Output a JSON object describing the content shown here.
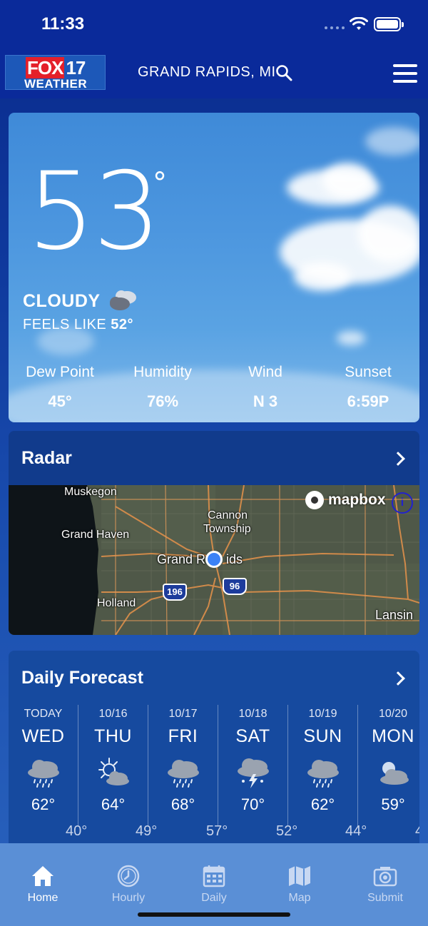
{
  "status": {
    "time": "11:33"
  },
  "header": {
    "logo_top_fox": "FOX",
    "logo_top_num": "17",
    "logo_bottom": "WEATHER",
    "location": "GRAND RAPIDS, MI"
  },
  "current": {
    "temperature": "53",
    "degree_symbol": "°",
    "condition": "CLOUDY",
    "feels_like_label": "FEELS LIKE",
    "feels_like_value": "52°",
    "metrics": [
      {
        "label": "Dew Point",
        "value": "45°"
      },
      {
        "label": "Humidity",
        "value": "76%"
      },
      {
        "label": "Wind",
        "value": "N 3"
      },
      {
        "label": "Sunset",
        "value": "6:59P"
      }
    ]
  },
  "radar": {
    "title": "Radar",
    "attribution": "mapbox",
    "info_glyph": "i",
    "places": {
      "muskegon": "Muskegon",
      "cannon": "Cannon",
      "township": "Township",
      "grand_haven": "Grand Haven",
      "grand_rapids_a": "Grand R",
      "grand_rapids_b": "ids",
      "holland": "Holland",
      "lansing": "Lansin"
    },
    "highways": [
      "196",
      "96"
    ]
  },
  "daily": {
    "title": "Daily Forecast",
    "days": [
      {
        "date": "TODAY",
        "day": "WED",
        "icon": "rain-icon",
        "high": "62°"
      },
      {
        "date": "10/16",
        "day": "THU",
        "icon": "partly-sunny-icon",
        "high": "64°"
      },
      {
        "date": "10/17",
        "day": "FRI",
        "icon": "rain-icon",
        "high": "68°"
      },
      {
        "date": "10/18",
        "day": "SAT",
        "icon": "thunderstorm-icon",
        "high": "70°"
      },
      {
        "date": "10/19",
        "day": "SUN",
        "icon": "rain-icon",
        "high": "62°"
      },
      {
        "date": "10/20",
        "day": "MON",
        "icon": "partly-cloudy-icon",
        "high": "59°"
      }
    ],
    "lows": [
      "40°",
      "49°",
      "57°",
      "52°",
      "44°",
      "4"
    ]
  },
  "tabs": [
    {
      "label": "Home",
      "icon": "home-icon",
      "active": true
    },
    {
      "label": "Hourly",
      "icon": "clock-icon",
      "active": false
    },
    {
      "label": "Daily",
      "icon": "calendar-icon",
      "active": false
    },
    {
      "label": "Map",
      "icon": "map-icon",
      "active": false
    },
    {
      "label": "Submit",
      "icon": "camera-icon",
      "active": false
    }
  ],
  "colors": {
    "header_bg": "#0a2a9a",
    "logo_red": "#e4202a",
    "tab_bar_bg": "#5a8fd6",
    "location_dot": "#3b82f6"
  }
}
